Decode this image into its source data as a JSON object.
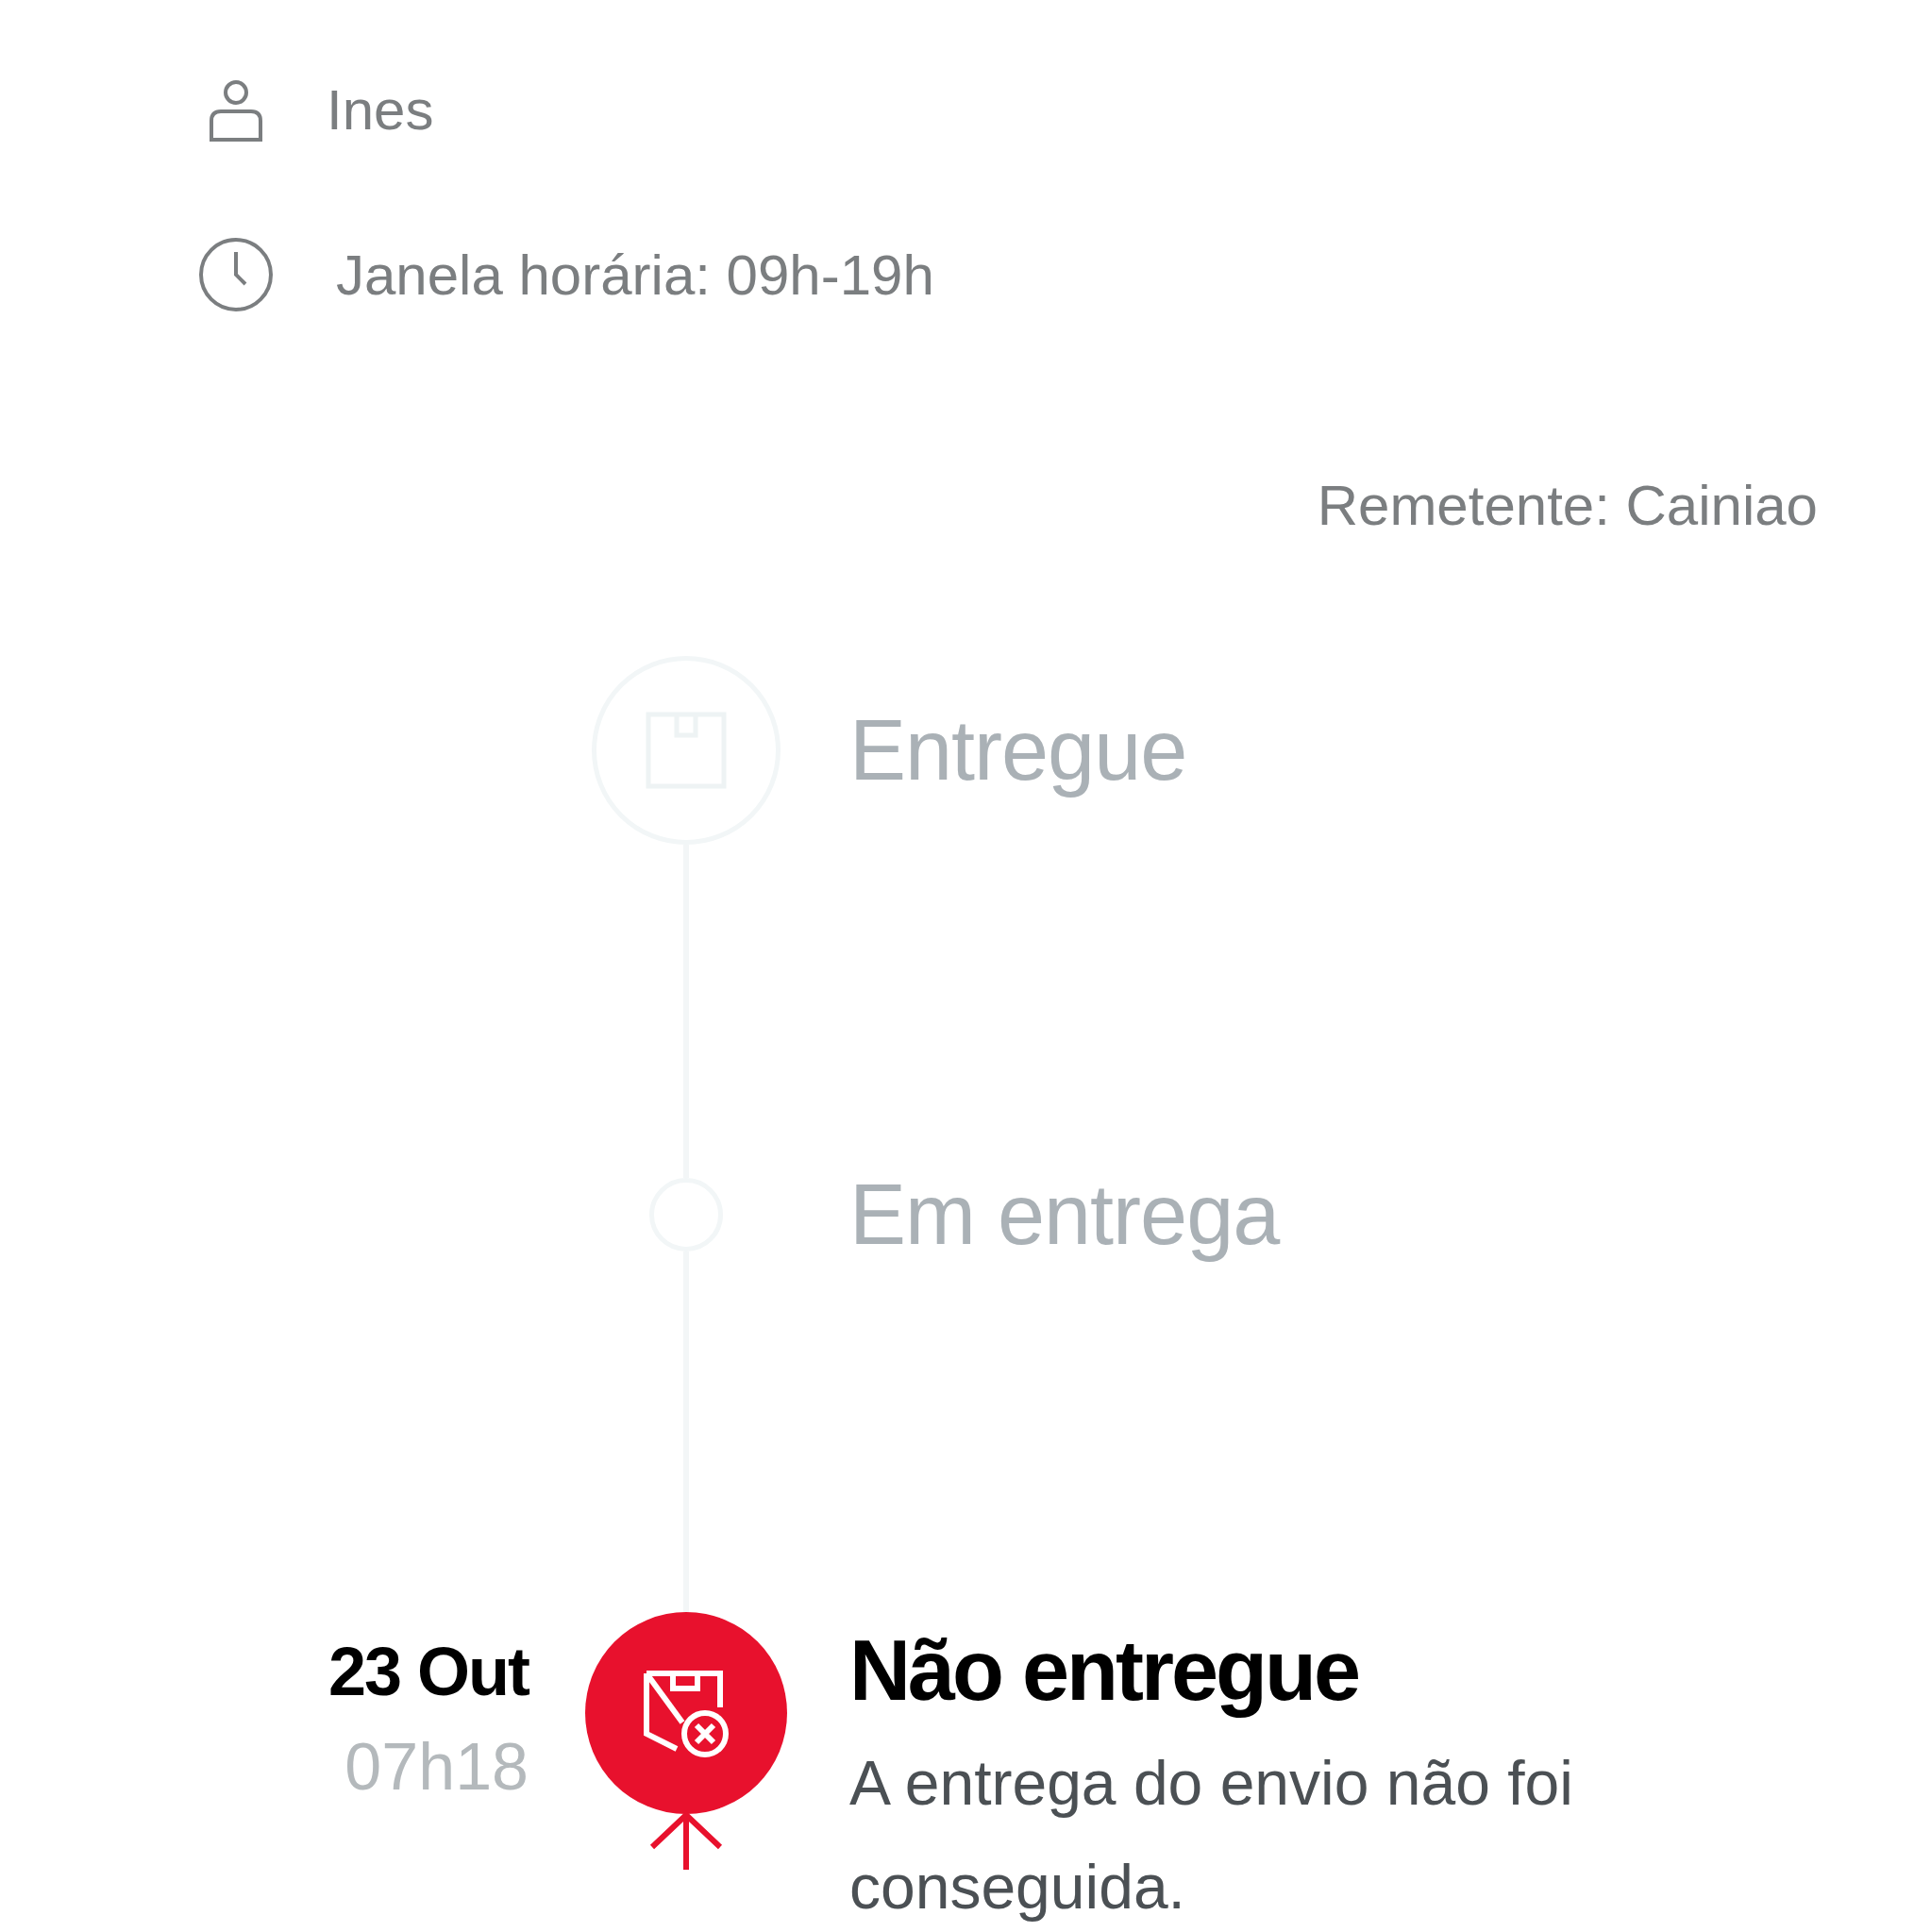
{
  "recipient": {
    "name": "Ines",
    "time_window": "Janela horária: 09h-19h"
  },
  "sender": "Remetente: Cainiao",
  "steps": [
    {
      "title": "Entregue",
      "kind": "milestone"
    },
    {
      "title": "Em entrega",
      "kind": "waypoint"
    },
    {
      "title": "Não entregue",
      "kind": "failed",
      "date": "23 Out",
      "time": "07h18",
      "description": "A entrega do envio não foi conseguida."
    }
  ]
}
